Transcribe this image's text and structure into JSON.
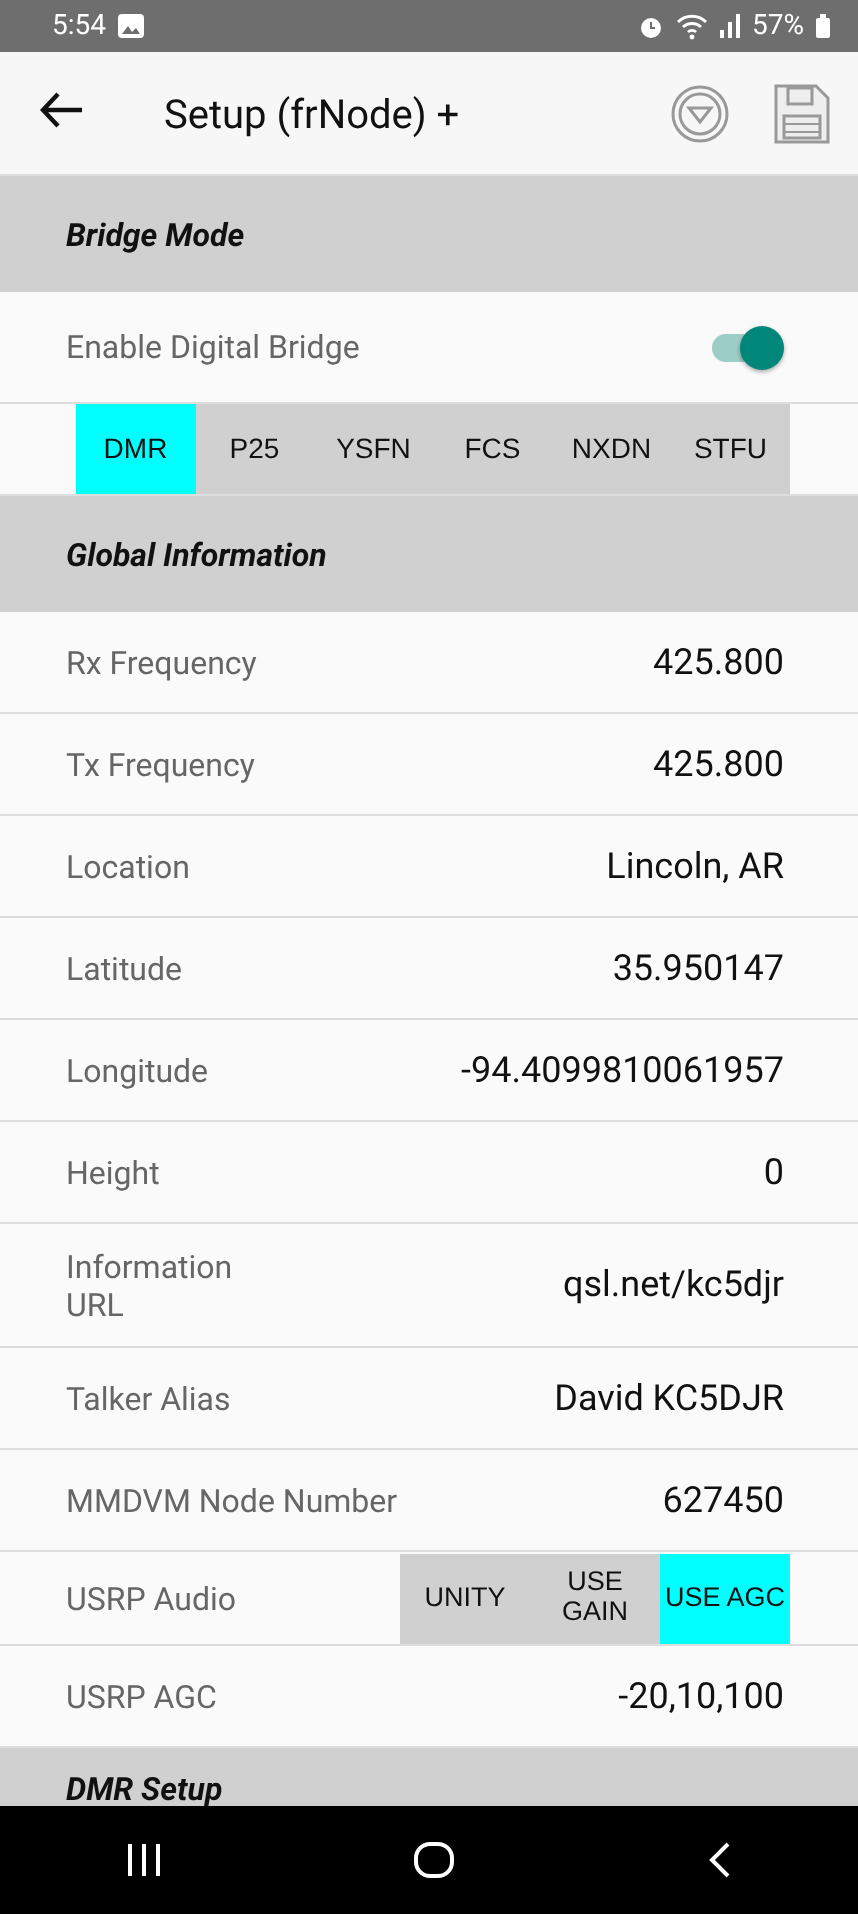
{
  "status_bar": {
    "time": "5:54",
    "battery": "57%"
  },
  "app_bar": {
    "title": "Setup (frNode) +"
  },
  "sections": [
    {
      "title": "Bridge Mode",
      "rows": [
        {
          "kind": "toggle",
          "label": "Enable Digital Bridge",
          "on": true
        },
        {
          "kind": "segments",
          "options": [
            {
              "label": "DMR",
              "selected": true
            },
            {
              "label": "P25",
              "selected": false
            },
            {
              "label": "YSFN",
              "selected": false
            },
            {
              "label": "FCS",
              "selected": false
            },
            {
              "label": "NXDN",
              "selected": false
            },
            {
              "label": "STFU",
              "selected": false
            }
          ]
        }
      ]
    },
    {
      "title": "Global Information",
      "rows": [
        {
          "kind": "value",
          "label": "Rx Frequency",
          "value": "425.800"
        },
        {
          "kind": "value",
          "label": "Tx Frequency",
          "value": "425.800"
        },
        {
          "kind": "value",
          "label": "Location",
          "value": "Lincoln, AR"
        },
        {
          "kind": "value",
          "label": "Latitude",
          "value": "35.950147"
        },
        {
          "kind": "value",
          "label": "Longitude",
          "value": "-94.4099810061957"
        },
        {
          "kind": "value",
          "label": "Height",
          "value": "0"
        },
        {
          "kind": "value",
          "label": "Information URL",
          "value": "qsl.net/kc5djr"
        },
        {
          "kind": "value",
          "label": "Talker Alias",
          "value": "David KC5DJR"
        },
        {
          "kind": "value",
          "label": "MMDVM Node Number",
          "value": "627450"
        },
        {
          "kind": "labeled_segments",
          "label": "USRP Audio",
          "options": [
            {
              "label": "UNITY",
              "selected": false
            },
            {
              "label": "USE GAIN",
              "selected": false
            },
            {
              "label": "USE AGC",
              "selected": true
            }
          ]
        },
        {
          "kind": "value",
          "label": "USRP AGC",
          "value": "-20,10,100"
        }
      ]
    },
    {
      "title": "DMR Setup"
    }
  ]
}
